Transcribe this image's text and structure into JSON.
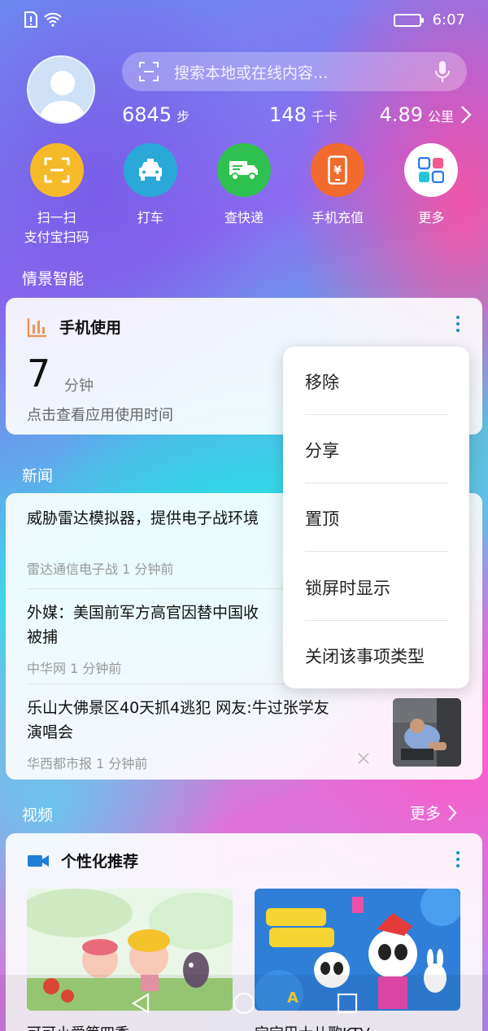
{
  "status": {
    "time": "6:07"
  },
  "search": {
    "placeholder": "搜索本地或在线内容..."
  },
  "stats": [
    {
      "value": "6845",
      "unit": "步"
    },
    {
      "value": "148",
      "unit": "千卡"
    },
    {
      "value": "4.89",
      "unit": "公里"
    }
  ],
  "quick_actions": [
    {
      "label": "扫一扫\n支付宝扫码",
      "line1": "扫一扫",
      "line2": "支付宝扫码",
      "color": "#f6b92a",
      "icon": "scan-icon"
    },
    {
      "label": "打车",
      "line1": "打车",
      "line2": "",
      "color": "#2aa8d8",
      "icon": "taxi-icon"
    },
    {
      "label": "查快递",
      "line1": "查快递",
      "line2": "",
      "color": "#2fc14f",
      "icon": "delivery-truck-icon"
    },
    {
      "label": "手机充值",
      "line1": "手机充值",
      "line2": "",
      "color": "#f26b2e",
      "icon": "phone-recharge-icon"
    },
    {
      "label": "更多",
      "line1": "更多",
      "line2": "",
      "color": "#ffffff",
      "icon": "more-apps-icon"
    }
  ],
  "sections": {
    "smart": "情景智能",
    "news": "新闻",
    "video": "视频",
    "video_more": "更多"
  },
  "usage_card": {
    "title": "手机使用",
    "value": "7",
    "unit": "分钟",
    "hint": "点击查看应用使用时间"
  },
  "news_items": [
    {
      "title": "威胁雷达模拟器，提供电子战环境",
      "meta": "雷达通信电子战  1 分钟前"
    },
    {
      "title": "外媒：美国前军方高官因替中国收集情报被捕",
      "title_l1": "外媒：美国前军方高官因替中国收",
      "title_l2": "被捕",
      "meta": "中华网  1 分钟前"
    },
    {
      "title_l1": "乐山大佛景区40天抓4逃犯 网友:牛过张学友",
      "title_l2": "演唱会",
      "meta": "华西都市报  1 分钟前"
    }
  ],
  "menu": [
    "移除",
    "分享",
    "置顶",
    "锁屏时显示",
    "关闭该事项类型"
  ],
  "video_card": {
    "title": "个性化推荐",
    "items": [
      "可可小爱第四季",
      "宝宝巴士儿歌KTV"
    ]
  }
}
